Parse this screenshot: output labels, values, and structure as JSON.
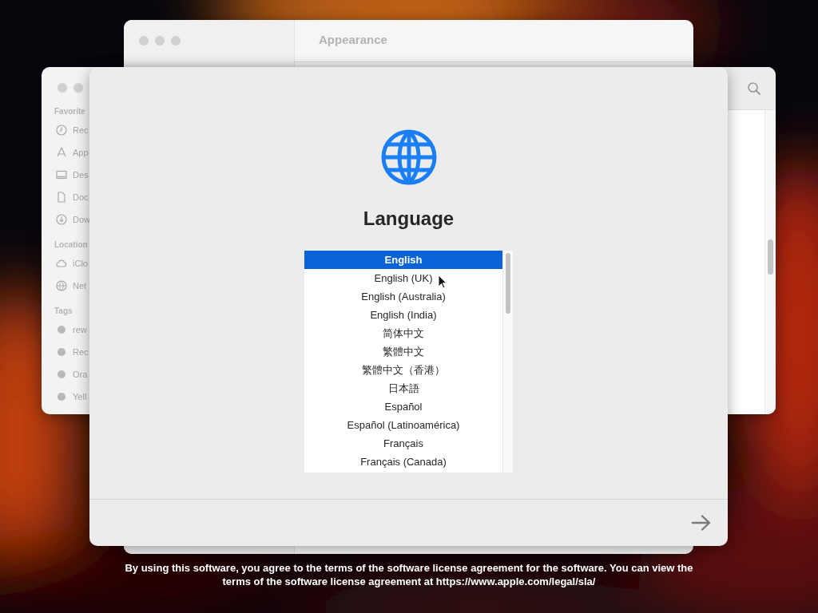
{
  "settings_window": {
    "title": "Appearance"
  },
  "finder_window": {
    "sections": [
      {
        "heading": "Favorite",
        "items": [
          {
            "label": "Rec",
            "kind": "clock"
          },
          {
            "label": "App",
            "kind": "apps"
          },
          {
            "label": "Des",
            "kind": "desktop"
          },
          {
            "label": "Doc",
            "kind": "document"
          },
          {
            "label": "Dow",
            "kind": "download"
          }
        ]
      },
      {
        "heading": "Location",
        "items": [
          {
            "label": "iClo",
            "kind": "cloud"
          },
          {
            "label": "Net",
            "kind": "network"
          }
        ]
      },
      {
        "heading": "Tags",
        "items": [
          {
            "label": "rew",
            "kind": "tag"
          },
          {
            "label": "Rec",
            "kind": "tag"
          },
          {
            "label": "Ora",
            "kind": "tag"
          },
          {
            "label": "Yell",
            "kind": "tag"
          }
        ]
      }
    ]
  },
  "installer": {
    "title": "Language",
    "languages": [
      {
        "label": "English",
        "selected": true
      },
      {
        "label": "English (UK)",
        "selected": false
      },
      {
        "label": "English (Australia)",
        "selected": false
      },
      {
        "label": "English (India)",
        "selected": false
      },
      {
        "label": "简体中文",
        "selected": false
      },
      {
        "label": "繁體中文",
        "selected": false
      },
      {
        "label": "繁體中文（香港）",
        "selected": false
      },
      {
        "label": "日本語",
        "selected": false
      },
      {
        "label": "Español",
        "selected": false
      },
      {
        "label": "Español (Latinoamérica)",
        "selected": false
      },
      {
        "label": "Français",
        "selected": false
      },
      {
        "label": "Français (Canada)",
        "selected": false
      }
    ]
  },
  "license_notice": "By using this software, you agree to the terms of the software license agreement for the software. You can view the terms of the software license agreement at https://www.apple.com/legal/sla/"
}
